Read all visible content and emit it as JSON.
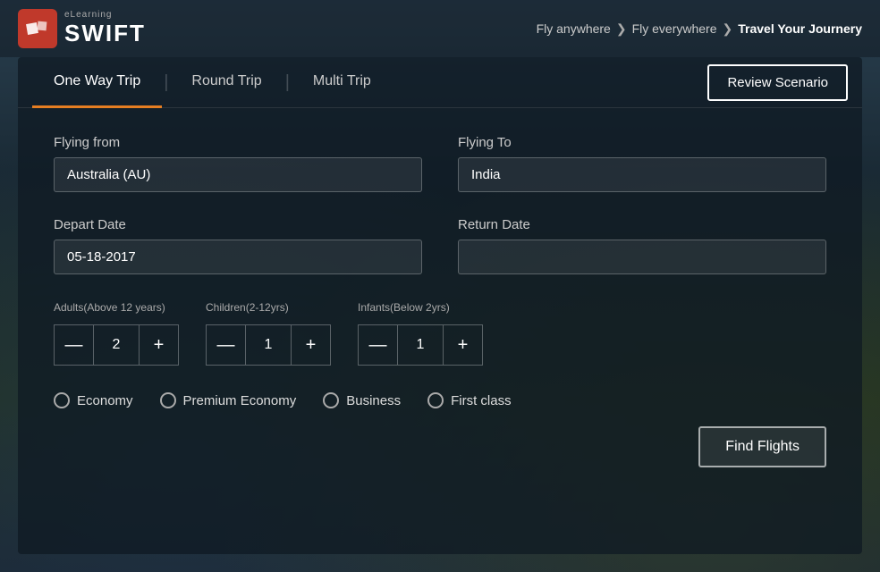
{
  "header": {
    "logo_elearning": "eLearning",
    "logo_swift": "SWIFT",
    "breadcrumb": {
      "item1": "Fly anywhere",
      "item2": "Fly everywhere",
      "item3": "Travel Your Journery",
      "sep": "❯"
    }
  },
  "tabs": {
    "tab1": "One Way Trip",
    "tab2": "Round Trip",
    "tab3": "Multi Trip",
    "review_btn": "Review Scenario"
  },
  "form": {
    "flying_from_label": "Flying from",
    "flying_from_value": "Australia (AU)",
    "flying_to_label": "Flying To",
    "flying_to_value": "India",
    "depart_date_label": "Depart Date",
    "depart_date_value": "05-18-2017",
    "return_date_label": "Return Date",
    "return_date_placeholder": ""
  },
  "passengers": {
    "adults_label": "Adults",
    "adults_sub": "(Above 12 years)",
    "adults_value": "2",
    "children_label": "Children",
    "children_sub": "(2-12yrs)",
    "children_value": "1",
    "infants_label": "Infants",
    "infants_sub": "(Below 2yrs)",
    "infants_value": "1"
  },
  "class_options": {
    "economy": "Economy",
    "premium_economy": "Premium Economy",
    "business": "Business",
    "first_class": "First class"
  },
  "find_flights_btn": "Find Flights",
  "stepper": {
    "minus": "—",
    "plus": "+"
  }
}
